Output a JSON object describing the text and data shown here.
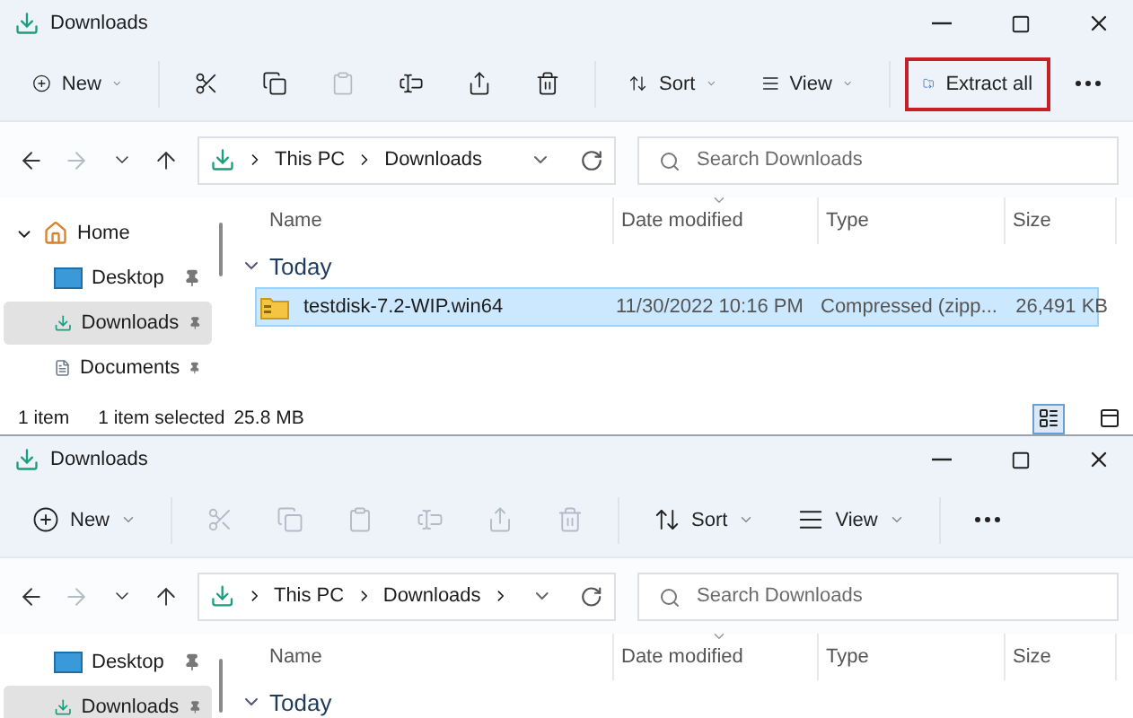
{
  "windows": [
    {
      "title": "Downloads",
      "toolbar": [
        {
          "kind": "new",
          "label": "New",
          "dropdown": true,
          "disabled": false,
          "highlighted": false
        },
        {
          "kind": "separator"
        },
        {
          "kind": "cut",
          "disabled": false,
          "highlighted": false
        },
        {
          "kind": "copy",
          "disabled": false,
          "highlighted": false
        },
        {
          "kind": "paste",
          "disabled": true,
          "highlighted": false
        },
        {
          "kind": "rename",
          "disabled": false,
          "highlighted": false
        },
        {
          "kind": "share",
          "disabled": false,
          "highlighted": false
        },
        {
          "kind": "delete",
          "disabled": false,
          "highlighted": false
        },
        {
          "kind": "separator"
        },
        {
          "kind": "sort",
          "label": "Sort",
          "dropdown": true,
          "disabled": false,
          "highlighted": false
        },
        {
          "kind": "view",
          "label": "View",
          "dropdown": true,
          "disabled": false,
          "highlighted": false
        },
        {
          "kind": "separator"
        },
        {
          "kind": "extract",
          "label": "Extract all",
          "dropdown": false,
          "disabled": false,
          "highlighted": true
        },
        {
          "kind": "more",
          "disabled": false,
          "highlighted": false
        }
      ],
      "nav": [
        {
          "kind": "back",
          "disabled": false
        },
        {
          "kind": "forward",
          "disabled": true
        },
        {
          "kind": "recent",
          "disabled": false
        },
        {
          "kind": "up",
          "disabled": false
        }
      ],
      "address": {
        "crumbs": [
          "This PC",
          "Downloads"
        ],
        "trailing_chevron": false
      },
      "search": {
        "placeholder": "Search Downloads"
      },
      "sidebar": [
        {
          "label": "Home",
          "kind": "home",
          "expanded": true,
          "pinned": false,
          "selected": false
        },
        {
          "label": "Desktop",
          "kind": "desktop",
          "pinned": true,
          "selected": false
        },
        {
          "label": "Downloads",
          "kind": "downloads",
          "pinned": true,
          "selected": true
        },
        {
          "label": "Documents",
          "kind": "documents",
          "pinned": true,
          "selected": false
        }
      ],
      "columns": [
        {
          "label": "Name",
          "sorted": false
        },
        {
          "label": "Date modified",
          "sorted": true
        },
        {
          "label": "Type",
          "sorted": false
        },
        {
          "label": "Size",
          "sorted": false
        }
      ],
      "groups": [
        {
          "label": "Today",
          "expanded": true,
          "files": [
            {
              "name": "testdisk-7.2-WIP.win64",
              "date": "11/30/2022 10:16 PM",
              "type": "Compressed (zipp...",
              "size": "26,491 KB",
              "selected": true
            }
          ]
        }
      ],
      "status_bar": {
        "count": "1 item",
        "selection": "1 item selected",
        "size": "25.8 MB",
        "views": [
          {
            "kind": "details",
            "selected": true
          },
          {
            "kind": "tiles",
            "selected": false
          }
        ]
      }
    },
    {
      "title": "Downloads",
      "toolbar": [
        {
          "kind": "new",
          "label": "New",
          "dropdown": true,
          "disabled": false,
          "highlighted": false
        },
        {
          "kind": "separator"
        },
        {
          "kind": "cut",
          "disabled": true,
          "highlighted": false
        },
        {
          "kind": "copy",
          "disabled": true,
          "highlighted": false
        },
        {
          "kind": "paste",
          "disabled": true,
          "highlighted": false
        },
        {
          "kind": "rename",
          "disabled": true,
          "highlighted": false
        },
        {
          "kind": "share",
          "disabled": true,
          "highlighted": false
        },
        {
          "kind": "delete",
          "disabled": true,
          "highlighted": false
        },
        {
          "kind": "separator"
        },
        {
          "kind": "sort",
          "label": "Sort",
          "dropdown": true,
          "disabled": false,
          "highlighted": false
        },
        {
          "kind": "view",
          "label": "View",
          "dropdown": true,
          "disabled": false,
          "highlighted": false
        },
        {
          "kind": "separator"
        },
        {
          "kind": "more",
          "disabled": false,
          "highlighted": false
        }
      ],
      "nav": [
        {
          "kind": "back",
          "disabled": false
        },
        {
          "kind": "forward",
          "disabled": true
        },
        {
          "kind": "recent",
          "disabled": false
        },
        {
          "kind": "up",
          "disabled": false
        }
      ],
      "address": {
        "crumbs": [
          "This PC",
          "Downloads"
        ],
        "trailing_chevron": true
      },
      "search": {
        "placeholder": "Search Downloads"
      },
      "sidebar": [
        {
          "label": "Desktop",
          "kind": "desktop",
          "pinned": true,
          "selected": false
        },
        {
          "label": "Downloads",
          "kind": "downloads",
          "pinned": true,
          "selected": true
        }
      ],
      "columns": [
        {
          "label": "Name",
          "sorted": false
        },
        {
          "label": "Date modified",
          "sorted": true
        },
        {
          "label": "Type",
          "sorted": false
        },
        {
          "label": "Size",
          "sorted": false
        }
      ],
      "groups": [
        {
          "label": "Today",
          "expanded": true
        }
      ]
    }
  ]
}
